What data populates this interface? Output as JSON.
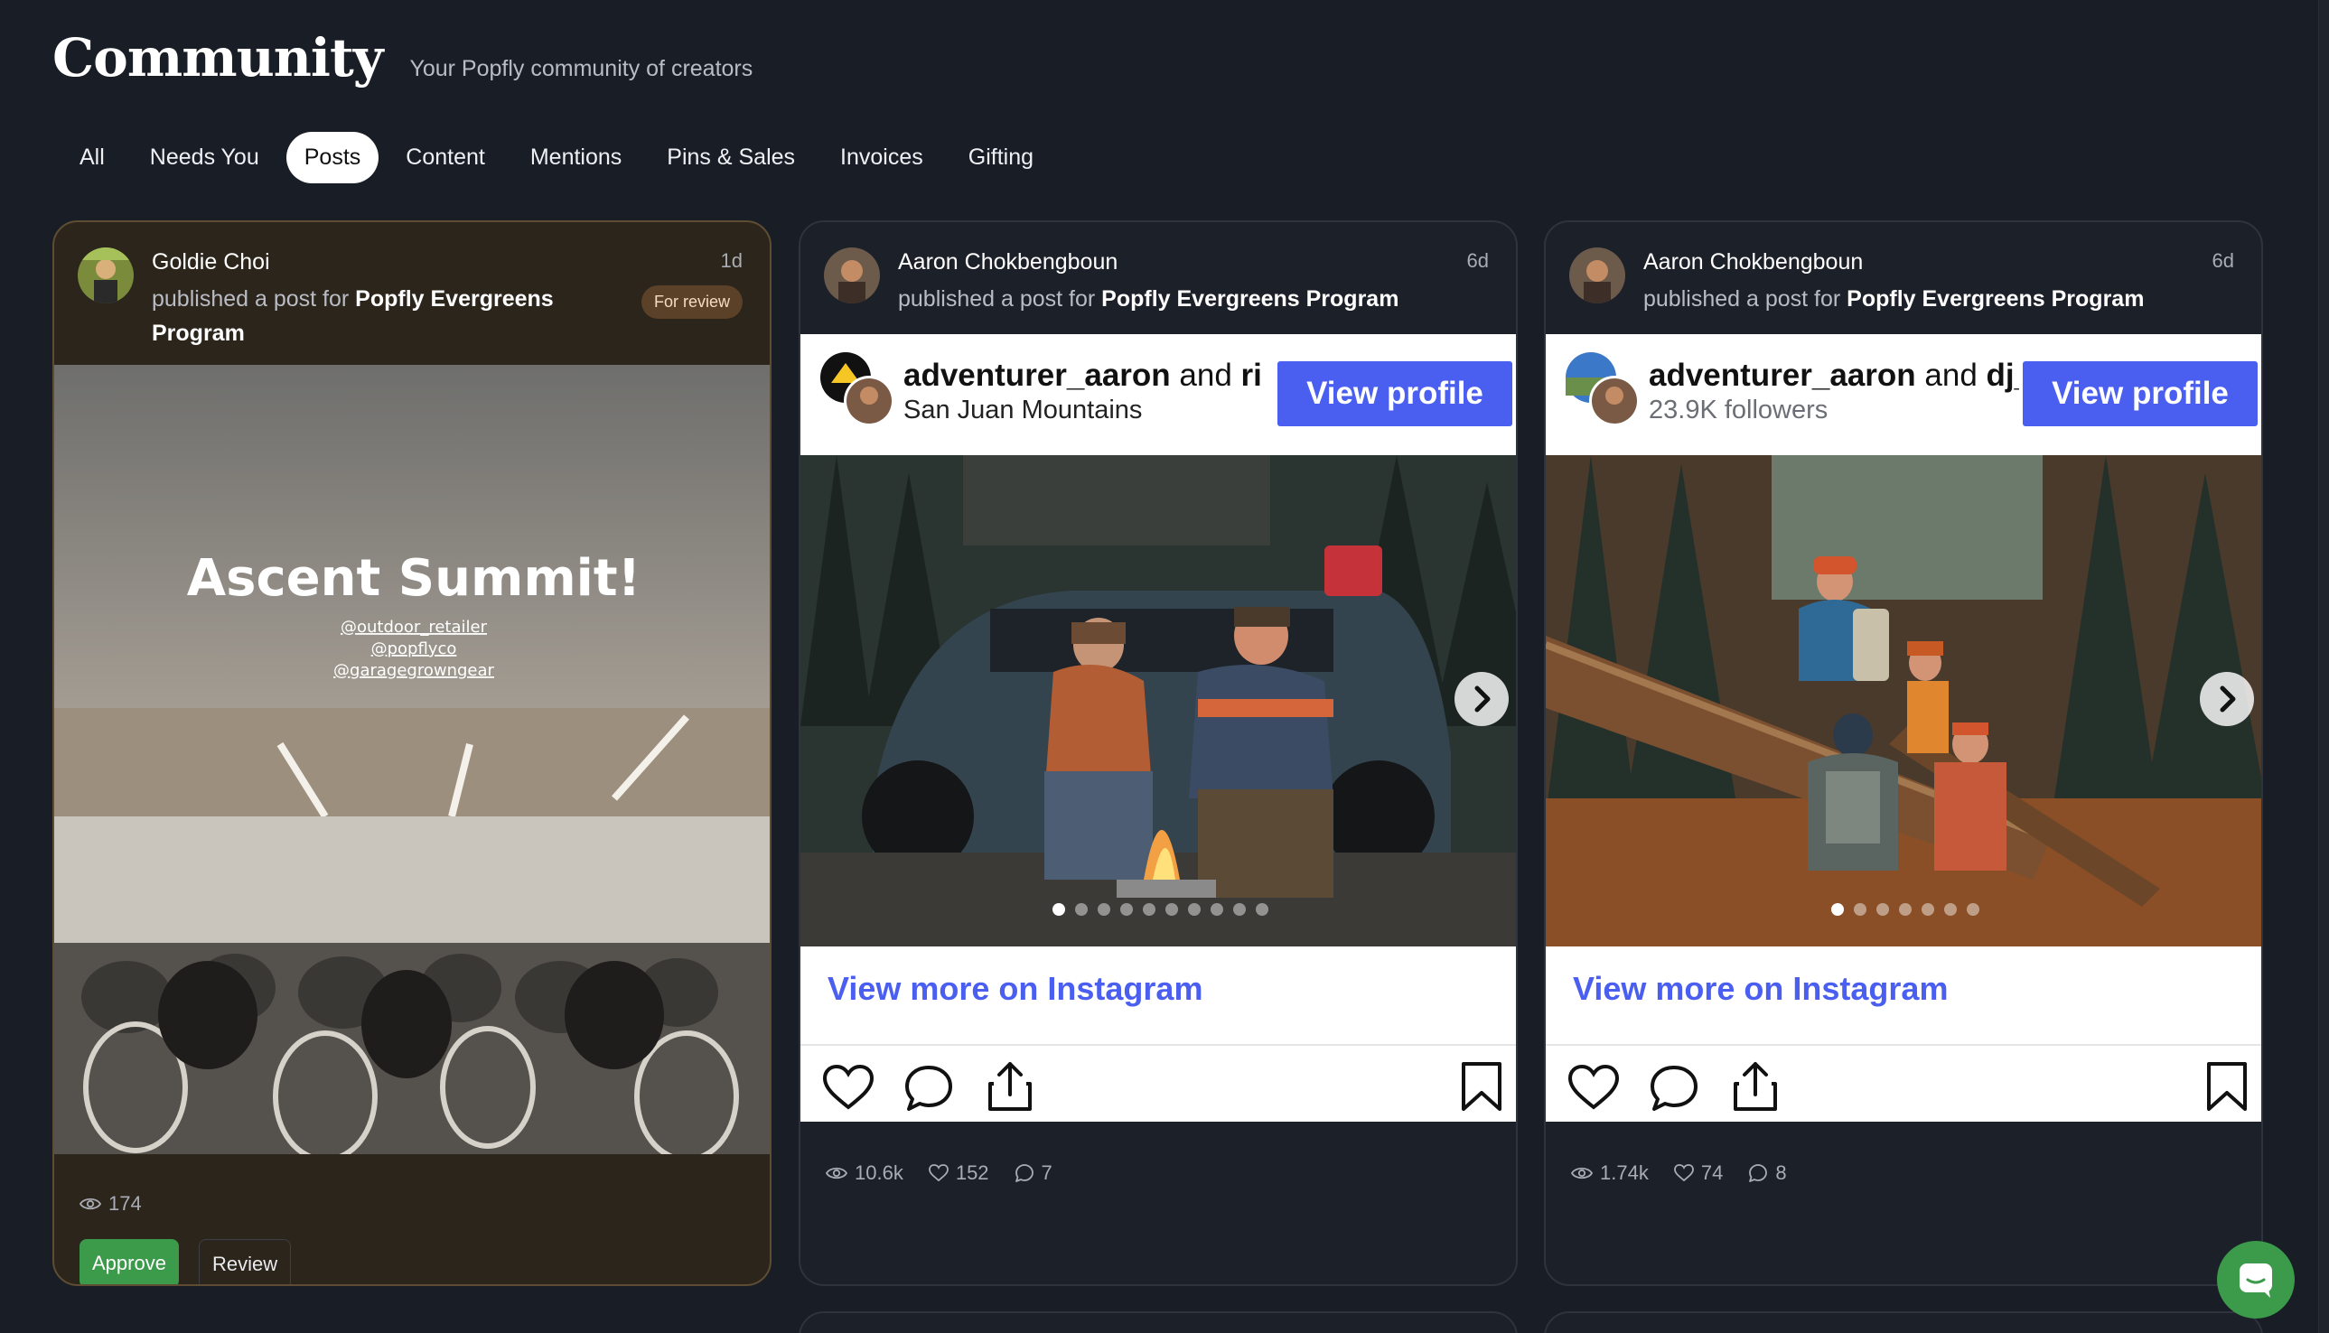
{
  "header": {
    "title": "Community",
    "subtitle": "Your Popfly community of creators"
  },
  "tabs": [
    {
      "label": "All",
      "active": false
    },
    {
      "label": "Needs You",
      "active": false
    },
    {
      "label": "Posts",
      "active": true
    },
    {
      "label": "Content",
      "active": false
    },
    {
      "label": "Mentions",
      "active": false
    },
    {
      "label": "Pins & Sales",
      "active": false
    },
    {
      "label": "Invoices",
      "active": false
    },
    {
      "label": "Gifting",
      "active": false
    }
  ],
  "cards": [
    {
      "creator": "Goldie Choi",
      "action_prefix": "published a post for",
      "program": "Popfly Evergreens Program",
      "age": "1d",
      "badge": "For review",
      "story": {
        "headline": "Ascent Summit!",
        "mentions": [
          "@outdoor_retailer",
          "@popflyco",
          "@garagegrowngear"
        ]
      },
      "views": "174",
      "approve_label": "Approve",
      "review_label": "Review"
    },
    {
      "creator": "Aaron Chokbengboun",
      "action_prefix": "published a post for",
      "program": "Popfly Evergreens Program",
      "age": "6d",
      "embed": {
        "handle": "adventurer_aaron",
        "and_text": "and",
        "coauthor": "ri",
        "subtitle": "San Juan Mountains",
        "view_profile": "View profile",
        "view_more": "View more on Instagram",
        "dots": 10,
        "active_dot": 0
      },
      "views": "10.6k",
      "likes": "152",
      "comments": "7"
    },
    {
      "creator": "Aaron Chokbengboun",
      "action_prefix": "published a post for",
      "program": "Popfly Evergreens Program",
      "age": "6d",
      "embed": {
        "handle": "adventurer_aaron",
        "and_text": "and",
        "coauthor": "dj_",
        "subtitle": "23.9K followers",
        "view_profile": "View profile",
        "view_more": "View more on Instagram",
        "dots": 7,
        "active_dot": 0
      },
      "views": "1.74k",
      "likes": "74",
      "comments": "8"
    }
  ],
  "colors": {
    "background": "#191d25",
    "accent_green": "#3c9a4b",
    "instagram_blue": "#4a5ef0",
    "review_card": "#2c251b"
  },
  "icons": [
    "eye-icon",
    "heart-icon",
    "comment-icon",
    "share-icon",
    "bookmark-icon",
    "chevron-right-icon",
    "chat-icon"
  ]
}
